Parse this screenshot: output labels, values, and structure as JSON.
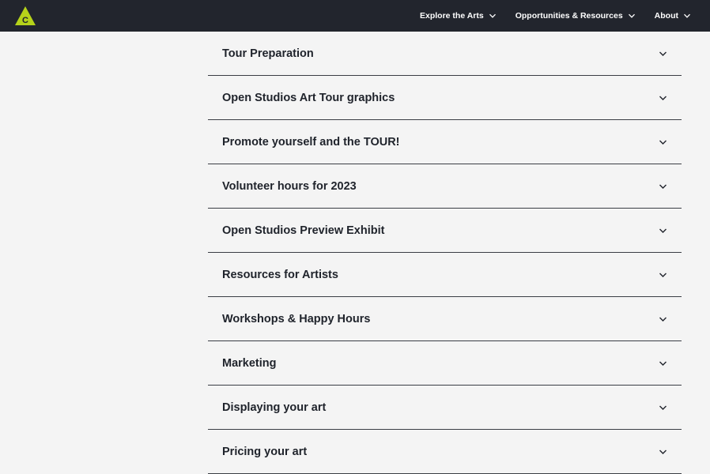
{
  "header": {
    "logo_icon": "c-triangle-logo-icon",
    "logo_color": "#b6d31a",
    "nav_items": [
      {
        "label": "Explore the Arts"
      },
      {
        "label": "Opportunities & Resources"
      },
      {
        "label": "About"
      }
    ]
  },
  "accordion": {
    "items": [
      {
        "title": "Tour Preparation"
      },
      {
        "title": "Open Studios Art Tour graphics"
      },
      {
        "title": "Promote yourself and the TOUR!"
      },
      {
        "title": "Volunteer hours for 2023"
      },
      {
        "title": "Open Studios Preview Exhibit"
      },
      {
        "title": "Resources for Artists"
      },
      {
        "title": "Workshops & Happy Hours"
      },
      {
        "title": "Marketing"
      },
      {
        "title": "Displaying your art"
      },
      {
        "title": "Pricing your art"
      }
    ]
  }
}
